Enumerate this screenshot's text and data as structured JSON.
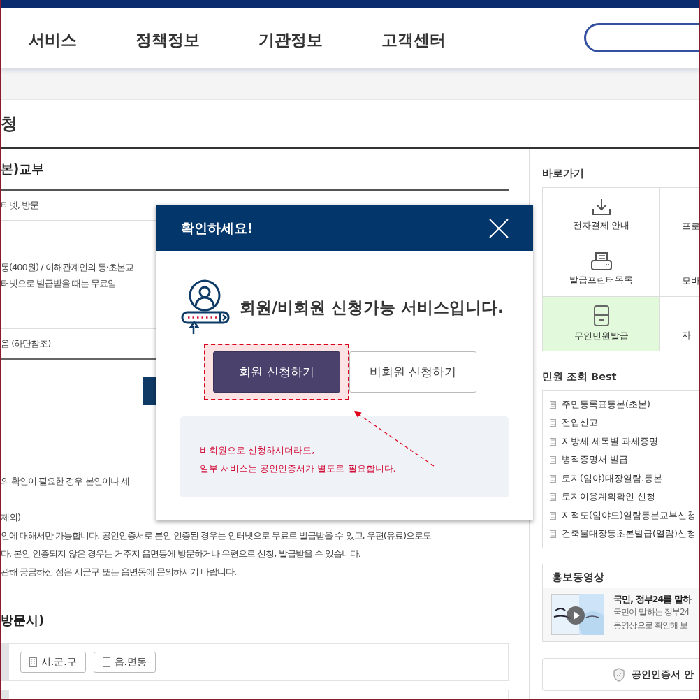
{
  "nav": {
    "items": [
      "서비스",
      "정책정보",
      "기관정보",
      "고객센터"
    ]
  },
  "page_title": "청",
  "main": {
    "heading": "본)교부",
    "method": "터넷, 방문",
    "fee_lines": [
      "통(400원) / 이해관계인의 등·초본교",
      "터넷으로 발급받을 때는 무료임"
    ],
    "note": "음 (하단참조)",
    "info_paragraphs": [
      [
        "의 확인이 필요한 경우 본인이나 세"
      ],
      [
        "제외)",
        "인에 대해서만 가능합니다. 공인인증서로 본인 인증된 경우는 인터넷으로 무료로 발급받을 수 있고, 우편(유료)으로도",
        "다. 본인 인증되지 않은 경우는 거주지 읍면동에 방문하거나 우편으로 신청, 발급받을 수 있습니다.",
        "관해 궁금하신 점은 시군구 또는 읍면동에 문의하시기 바랍니다."
      ]
    ],
    "visit_heading": "방문시)",
    "office_buttons": [
      "시.군.구",
      "읍.면동"
    ]
  },
  "sidebar": {
    "shortcuts_title": "바로가기",
    "shortcuts": [
      {
        "label": "전자결제 안내",
        "kind": "download",
        "selected": false
      },
      {
        "label": "프로",
        "kind": "none",
        "selected": false
      },
      {
        "label": "발급프린터목록",
        "kind": "printer",
        "selected": false
      },
      {
        "label": "모바",
        "kind": "none",
        "selected": false
      },
      {
        "label": "무인민원발급",
        "kind": "kiosk",
        "selected": true
      },
      {
        "label": "자",
        "kind": "none",
        "selected": false
      }
    ],
    "best_title": "민원 조회 Best",
    "best_items": [
      "주민등록표등본(초본)",
      "전입신고",
      "지방세 세목별 과세증명",
      "병적증명서 발급",
      "토지(임야)대장열람.등본",
      "토지이용계획확인 신청",
      "지적도(임야도)열람등본교부신청",
      "건축물대장등초본발급(열람)신청"
    ],
    "video": {
      "title": "홍보동영상",
      "headline": "국민, 정부24를 말하",
      "desc_lines": [
        "국민이 말하는 정부24",
        "동영상으로 확인해 보"
      ]
    },
    "cert_link": "**공인인증서** 안"
  },
  "modal": {
    "title": "확인하세요!",
    "message": "회원/비회원 신청가능 서비스입니다.",
    "buttons": [
      {
        "label": "회원 신청하기",
        "kind": "primary",
        "highlighted": true
      },
      {
        "label": "비회원 신청하기",
        "kind": "secondary",
        "highlighted": false
      }
    ],
    "notice_lines": [
      "비회원으로 신청하시더라도,",
      "일부 서비스는 공인인증서가 별도로 필요합니다."
    ]
  }
}
